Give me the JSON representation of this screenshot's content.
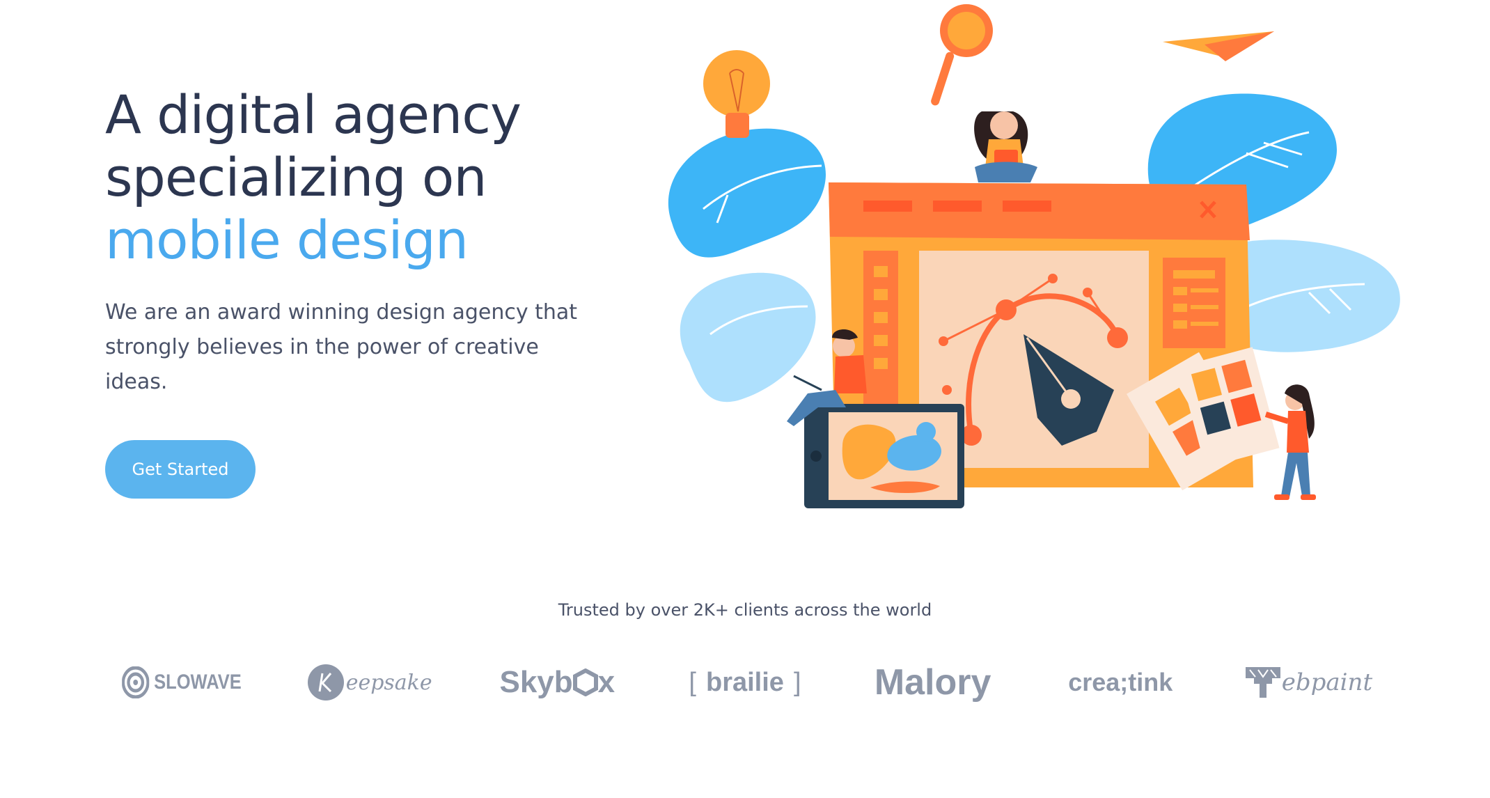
{
  "hero": {
    "headline_line1": "A digital agency",
    "headline_line2": "specializing on",
    "headline_accent": "mobile design",
    "lead_line1": "We are an award winning design agency that",
    "lead_line2": "strongly believes in the power of creative ideas.",
    "cta_label": "Get Started"
  },
  "trusted": {
    "text": "Trusted by over 2K+ clients across the world"
  },
  "logos": [
    {
      "name": "SLOWAVE",
      "icon": "target-circle-icon"
    },
    {
      "name": "eepsake",
      "icon": "k-circle-icon"
    },
    {
      "name": "Skyb",
      "suffix": "x",
      "icon": "hexagon-icon"
    },
    {
      "name": "brailie"
    },
    {
      "name": "Malory"
    },
    {
      "name": "crea;tink"
    },
    {
      "name": "ebpaint",
      "icon": "paint-roller-icon"
    }
  ],
  "colors": {
    "heading": "#2c3650",
    "accent": "#4aa9ee",
    "button": "#5bb4ee",
    "logo_gray": "#8e97a8",
    "orange": "#ff7a3d",
    "yellow_orange": "#ffa83a",
    "blue_blob": "#3db5f7",
    "light_blue_blob": "#aee0fd",
    "navy": "#274156"
  }
}
